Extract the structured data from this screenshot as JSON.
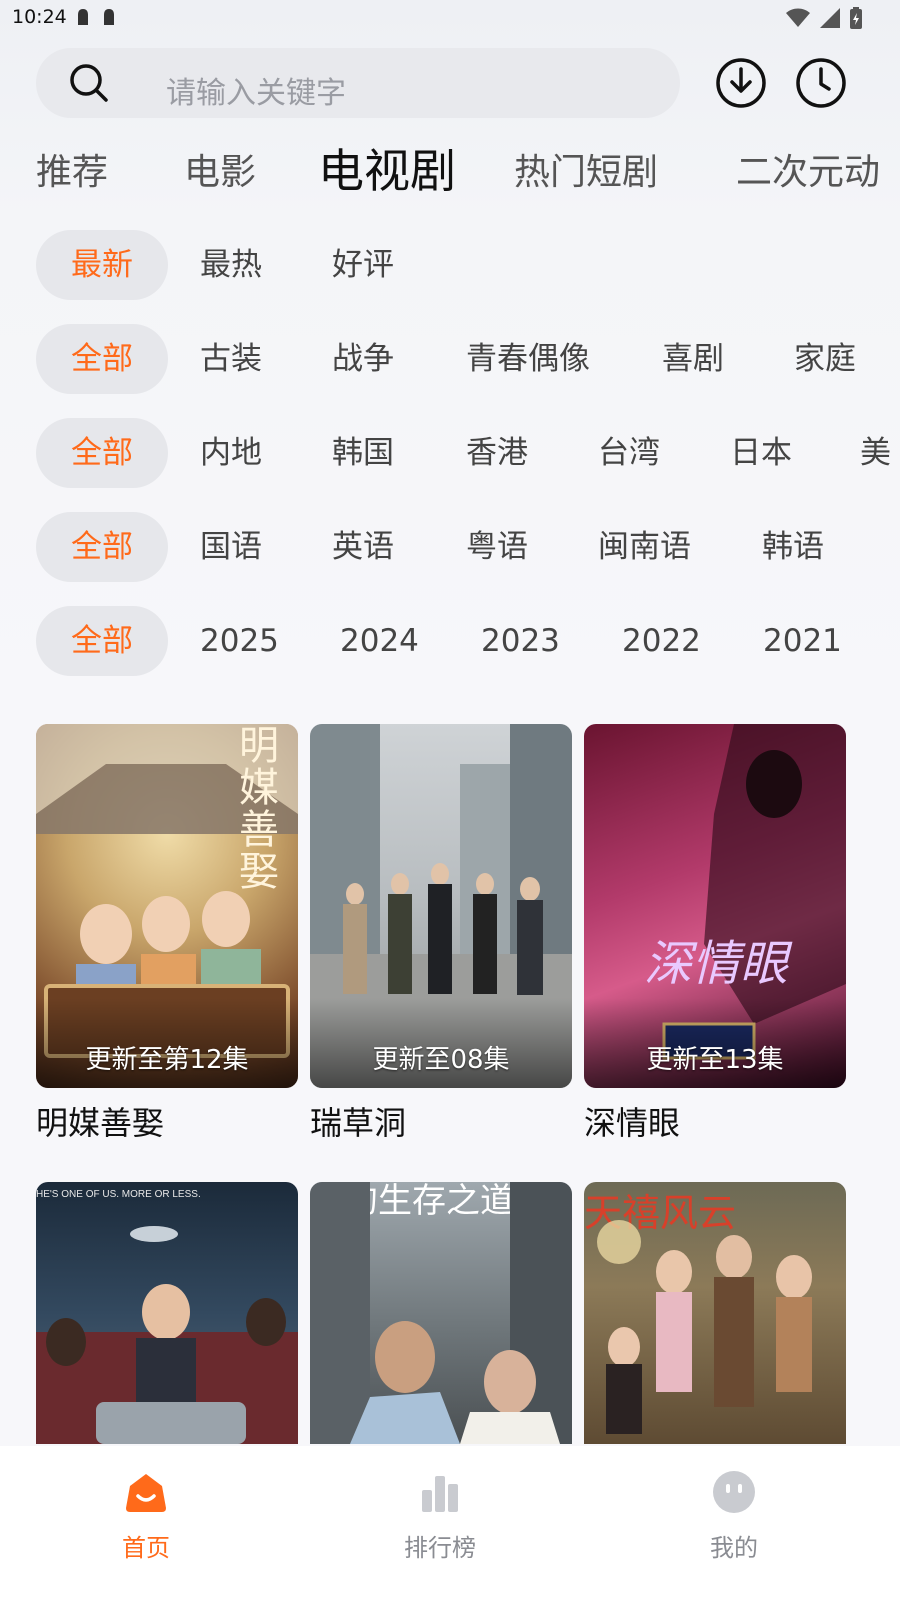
{
  "status": {
    "time": "10:24"
  },
  "search": {
    "placeholder": "请输入关键字"
  },
  "category_tabs": [
    {
      "label": "推荐"
    },
    {
      "label": "电影"
    },
    {
      "label": "电视剧",
      "active": true
    },
    {
      "label": "热门短剧"
    },
    {
      "label": "二次元动"
    }
  ],
  "filters": {
    "sort": [
      "最新",
      "最热",
      "好评"
    ],
    "genre": [
      "全部",
      "古装",
      "战争",
      "青春偶像",
      "喜剧",
      "家庭"
    ],
    "region": [
      "全部",
      "内地",
      "韩国",
      "香港",
      "台湾",
      "日本",
      "美"
    ],
    "language": [
      "全部",
      "国语",
      "英语",
      "粤语",
      "闽南语",
      "韩语"
    ],
    "year": [
      "全部",
      "2025",
      "2024",
      "2023",
      "2022",
      "2021"
    ]
  },
  "shows": [
    {
      "title": "明媒善娶",
      "update": "更新至第12集",
      "art_title": "明媒善娶"
    },
    {
      "title": "瑞草洞",
      "update": "更新至08集",
      "art_title": ""
    },
    {
      "title": "深情眼",
      "update": "更新至13集",
      "art_title": "深情眼"
    }
  ],
  "shows_row2": [
    {
      "tagline": "HE'S ONE OF US. MORE OR LESS."
    },
    {
      "art_title": "她的生存之道"
    },
    {
      "art_title": "天禧风云"
    }
  ],
  "bottom_nav": [
    {
      "label": "首页",
      "icon": "home-icon",
      "active": true
    },
    {
      "label": "排行榜",
      "icon": "bar-chart-icon"
    },
    {
      "label": "我的",
      "icon": "profile-icon"
    }
  ],
  "colors": {
    "accent": "#ff6a1a",
    "chip_bg": "#e6e7eb"
  }
}
